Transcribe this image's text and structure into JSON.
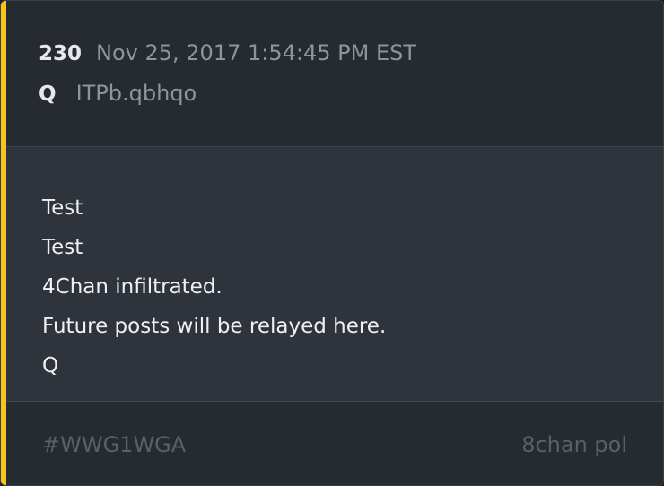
{
  "post": {
    "number": "230",
    "timestamp": "Nov 25, 2017 1:54:45 PM EST",
    "author": "Q",
    "trip": "ITPb.qbhqo"
  },
  "body": {
    "lines": [
      "Test",
      "Test",
      "4Chan infiltrated.",
      "Future posts will be relayed here.",
      "Q"
    ]
  },
  "footer": {
    "hashtag": "#WWG1WGA",
    "source": "8chan pol"
  },
  "colors": {
    "accent": "#f4c51f",
    "card_background": "#262a31",
    "body_background": "#2f343c"
  }
}
